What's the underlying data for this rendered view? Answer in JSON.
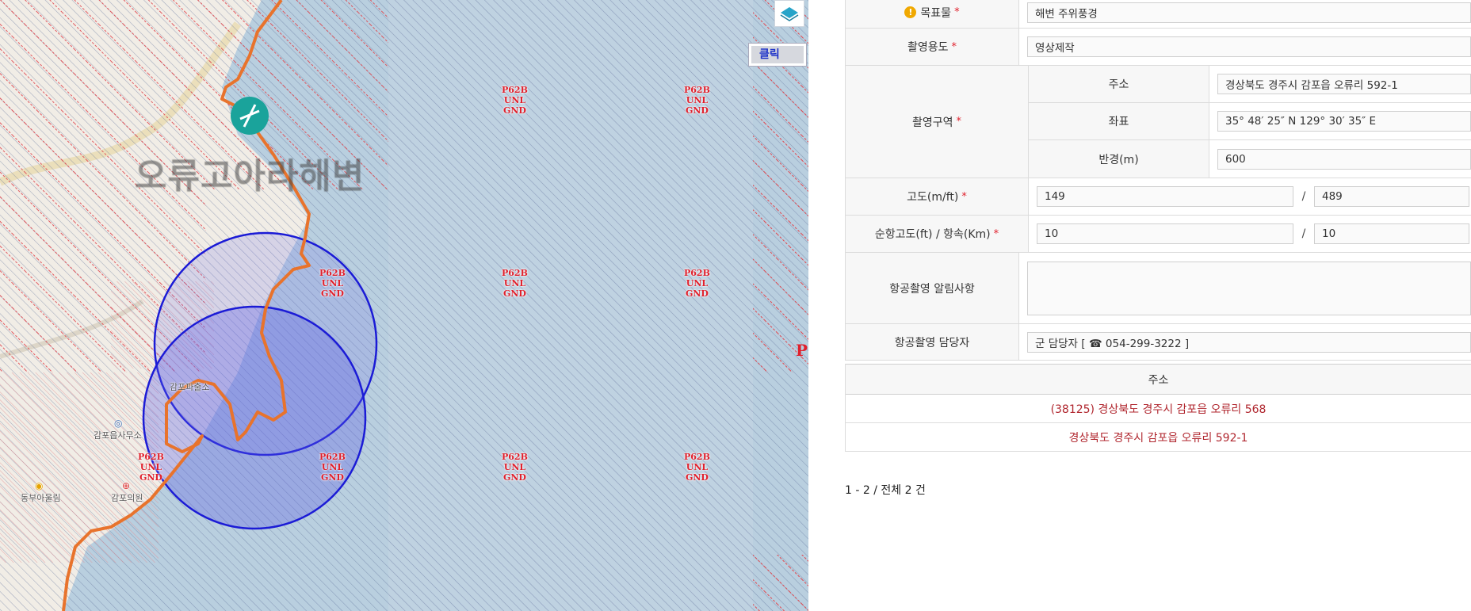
{
  "map": {
    "place_name": "오류고아라해변",
    "zone_code": "P62B",
    "zone_upper": "UNL",
    "zone_lower": "GND",
    "edge_text": "P",
    "click_button": "클릭",
    "layer_icon": "layers-icon",
    "pois": [
      {
        "label": "감포읍사무소",
        "icon": "government-office-icon"
      },
      {
        "label": "감포파출소",
        "icon": "police-icon"
      },
      {
        "label": "감포의원",
        "icon": "hospital-icon"
      },
      {
        "label": "동부아울림",
        "icon": "facility-icon"
      }
    ],
    "colors": {
      "route": "#e8732c",
      "circle": "#1b1bd6",
      "restricted": "#e0202c",
      "sea": "#b9cfdf"
    }
  },
  "form": {
    "target": {
      "label": "목표물",
      "value": "해변 주위풍경",
      "icon": "warning-icon"
    },
    "purpose": {
      "label": "촬영용도",
      "value": "영상제작"
    },
    "area": {
      "label": "촬영구역",
      "address_label": "주소",
      "address_value": "경상북도 경주시 감포읍 오류리 592-1",
      "coord_label": "좌표",
      "coord_value": "35° 48′ 25″ N 129° 30′ 35″ E",
      "radius_label": "반경(m)",
      "radius_value": "600"
    },
    "altitude": {
      "label": "고도(m/ft)",
      "meters": "149",
      "separator": "/",
      "feet": "489"
    },
    "cruise": {
      "label": "순항고도(ft) / 항속(Km)",
      "altitude": "10",
      "separator": "/",
      "speed": "10"
    },
    "notice": {
      "label": "항공촬영 알림사항",
      "value": ""
    },
    "contact": {
      "label": "항공촬영 담당자",
      "value": "군 담당자 [ ☎ 054-299-3222 ]"
    },
    "required_mark": "*"
  },
  "address_table": {
    "header": "주소",
    "rows": [
      "(38125) 경상북도 경주시 감포읍 오류리 568",
      "경상북도 경주시 감포읍 오류리 592-1"
    ],
    "count": "1 - 2 / 전체 2 건"
  }
}
